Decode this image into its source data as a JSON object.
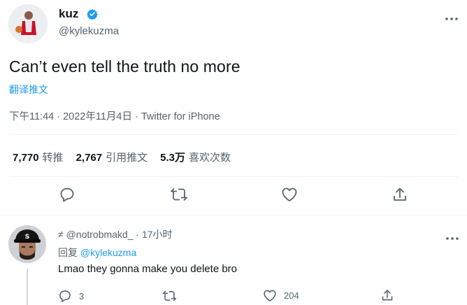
{
  "tweet": {
    "author": {
      "name": "kuz",
      "handle": "@kylekuzma",
      "verified": true
    },
    "text": "Can’t even tell the truth no more",
    "translate_label": "翻译推文",
    "meta": "下午11:44 · 2022年11月4日 · Twitter for iPhone",
    "stats": [
      {
        "count": "7,770",
        "label": "转推"
      },
      {
        "count": "2,767",
        "label": "引用推文"
      },
      {
        "count": "5.3万",
        "label": "喜欢次数"
      }
    ],
    "actions": [
      "reply-icon",
      "retweet-icon",
      "like-icon",
      "share-icon"
    ]
  },
  "reply": {
    "handle_line": "≠ @notrobmakd_ · 17小时",
    "replying_prefix": "回复",
    "replying_mention": "@kylekuzma",
    "text": "Lmao they gonna make you delete bro",
    "reply_count": "3",
    "like_count": "204"
  },
  "colors": {
    "accent": "#1d9bf0",
    "muted": "#536471",
    "text": "#0f1419"
  }
}
